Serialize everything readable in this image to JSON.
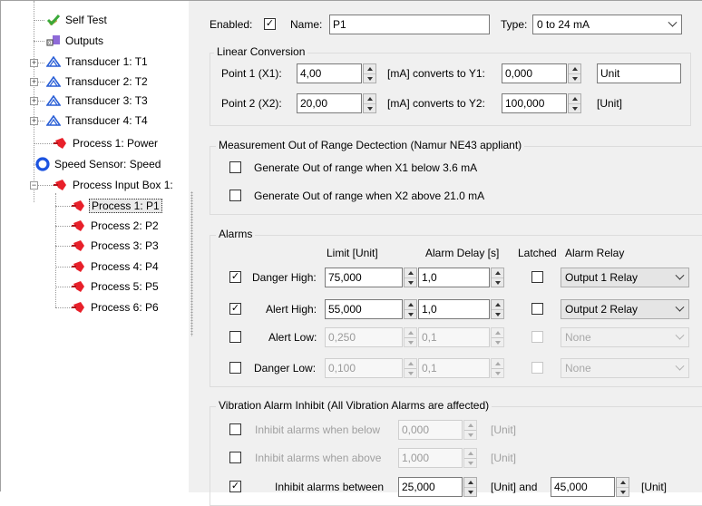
{
  "tree": {
    "items": [
      {
        "label": "Self Test",
        "icon": "check-tool-icon"
      },
      {
        "label": "Outputs",
        "icon": "outputs-icon"
      },
      {
        "label": "Transducer 1: T1",
        "icon": "transducer-icon"
      },
      {
        "label": "Transducer 2: T2",
        "icon": "transducer-icon"
      },
      {
        "label": "Transducer 3: T3",
        "icon": "transducer-icon"
      },
      {
        "label": "Transducer 4: T4",
        "icon": "transducer-icon"
      },
      {
        "label": "Process 1: Power",
        "icon": "process-icon"
      },
      {
        "label": "Speed Sensor: Speed",
        "icon": "speed-sensor-icon"
      },
      {
        "label": "Process Input Box 1:",
        "icon": "process-icon"
      },
      {
        "label": "Process 1: P1",
        "icon": "process-icon"
      },
      {
        "label": "Process 2: P2",
        "icon": "process-icon"
      },
      {
        "label": "Process 3: P3",
        "icon": "process-icon"
      },
      {
        "label": "Process 4: P4",
        "icon": "process-icon"
      },
      {
        "label": "Process 5: P5",
        "icon": "process-icon"
      },
      {
        "label": "Process 6: P6",
        "icon": "process-icon"
      }
    ],
    "selected": "Process 1: P1"
  },
  "top": {
    "enabled_label": "Enabled:",
    "enabled_checked": true,
    "name_label": "Name:",
    "name_value": "P1",
    "type_label": "Type:",
    "type_value": "0 to 24 mA"
  },
  "linear": {
    "title": "Linear Conversion",
    "p1_label": "Point 1  (X1):",
    "p1_x": "4,00",
    "p1_conv": "[mA] converts to Y1:",
    "p1_y": "0,000",
    "p1_unit": "Unit",
    "p2_label": "Point 2  (X2):",
    "p2_x": "20,00",
    "p2_conv": "[mA] converts to Y2:",
    "p2_y": "100,000",
    "p2_unit": "[Unit]"
  },
  "range": {
    "title": "Measurement Out of Range Dectection (Namur NE43 appliant)",
    "opt1": "Generate Out of range when X1 below 3.6 mA",
    "opt2": "Generate Out of range when X2 above 21.0 mA"
  },
  "alarms": {
    "title": "Alarms",
    "col_limit": "Limit [Unit]",
    "col_delay": "Alarm Delay [s]",
    "col_latched": "Latched",
    "col_relay": "Alarm Relay",
    "rows": [
      {
        "label": "Danger High:",
        "checked": true,
        "limit": "75,000",
        "delay": "1,0",
        "relay": "Output 1 Relay",
        "enabled": true
      },
      {
        "label": "Alert High:",
        "checked": true,
        "limit": "55,000",
        "delay": "1,0",
        "relay": "Output 2 Relay",
        "enabled": true
      },
      {
        "label": "Alert Low:",
        "checked": false,
        "limit": "0,250",
        "delay": "0,1",
        "relay": "None",
        "enabled": false
      },
      {
        "label": "Danger Low:",
        "checked": false,
        "limit": "0,100",
        "delay": "0,1",
        "relay": "None",
        "enabled": false
      }
    ]
  },
  "inhibit": {
    "title": "Vibration Alarm Inhibit (All Vibration Alarms are affected)",
    "below_label": "Inhibit alarms when below",
    "below_value": "0,000",
    "below_unit": "[Unit]",
    "above_label": "Inhibit alarms when above",
    "above_value": "1,000",
    "above_unit": "[Unit]",
    "between_label": "Inhibit alarms between",
    "between_from": "25,000",
    "between_and": "[Unit] and",
    "between_to": "45,000",
    "between_unit": "[Unit]"
  },
  "check_mark": "✓",
  "colors": {
    "process_icon": "#e8202a",
    "transducer_icon": "#2a5fd6",
    "speed_icon": "#1c53e0",
    "selftest_icon": "#3aa93a"
  }
}
